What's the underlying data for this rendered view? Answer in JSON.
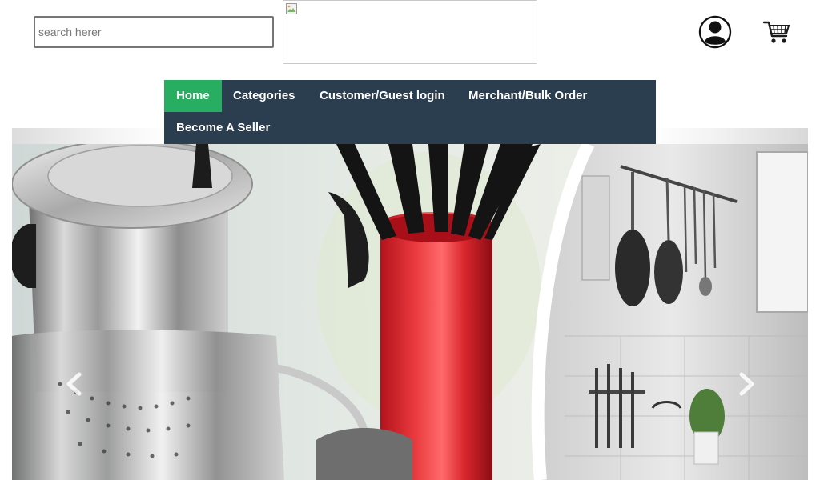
{
  "header": {
    "search": {
      "placeholder": "search herer",
      "value": ""
    },
    "logo_icon": "broken-image-icon",
    "account_icon": "user-account-icon",
    "cart_icon": "shopping-cart-icon"
  },
  "nav": {
    "items": [
      {
        "label": "Home",
        "active": true
      },
      {
        "label": "Categories",
        "active": false
      },
      {
        "label": "Customer/Guest login",
        "active": false
      },
      {
        "label": "Merchant/Bulk Order",
        "active": false
      },
      {
        "label": "Become A Seller",
        "active": false
      }
    ],
    "colors": {
      "bar": "#2b3e50",
      "active": "#27ae60",
      "text": "#ffffff"
    }
  },
  "carousel": {
    "prev_icon": "chevron-left-icon",
    "next_icon": "chevron-right-icon",
    "image": "kitchen-utensils-photo"
  }
}
